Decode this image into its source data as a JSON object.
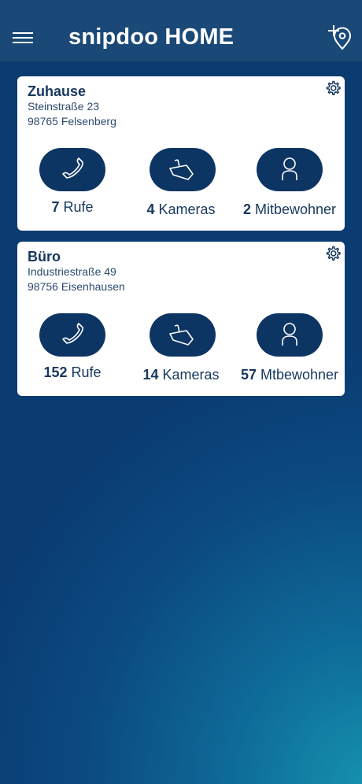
{
  "header": {
    "title": "snipdoo HOME",
    "menu_icon": "hamburger-menu-icon",
    "add_location_icon": "add-location-pin-icon"
  },
  "locations": [
    {
      "name": "Zuhause",
      "street": "Steinstraße 23",
      "city": "98765 Felsenberg",
      "calls_count": "7",
      "calls_label": "Rufe",
      "cameras_count": "4",
      "cameras_label": "Kameras",
      "residents_count": "2",
      "residents_label": "Mitbewohner"
    },
    {
      "name": "Büro",
      "street": "Industriestraße 49",
      "city": "98756 Eisenhausen",
      "calls_count": "152",
      "calls_label": "Rufe",
      "cameras_count": "14",
      "cameras_label": "Kameras",
      "residents_count": "57",
      "residents_label": "Mtbewohner"
    }
  ],
  "colors": {
    "header_bg": "#1a4877",
    "pill_bg": "#0d3563",
    "card_text": "#17375e",
    "gradient_light": "#1592ae",
    "gradient_dark": "#0a3c72"
  }
}
